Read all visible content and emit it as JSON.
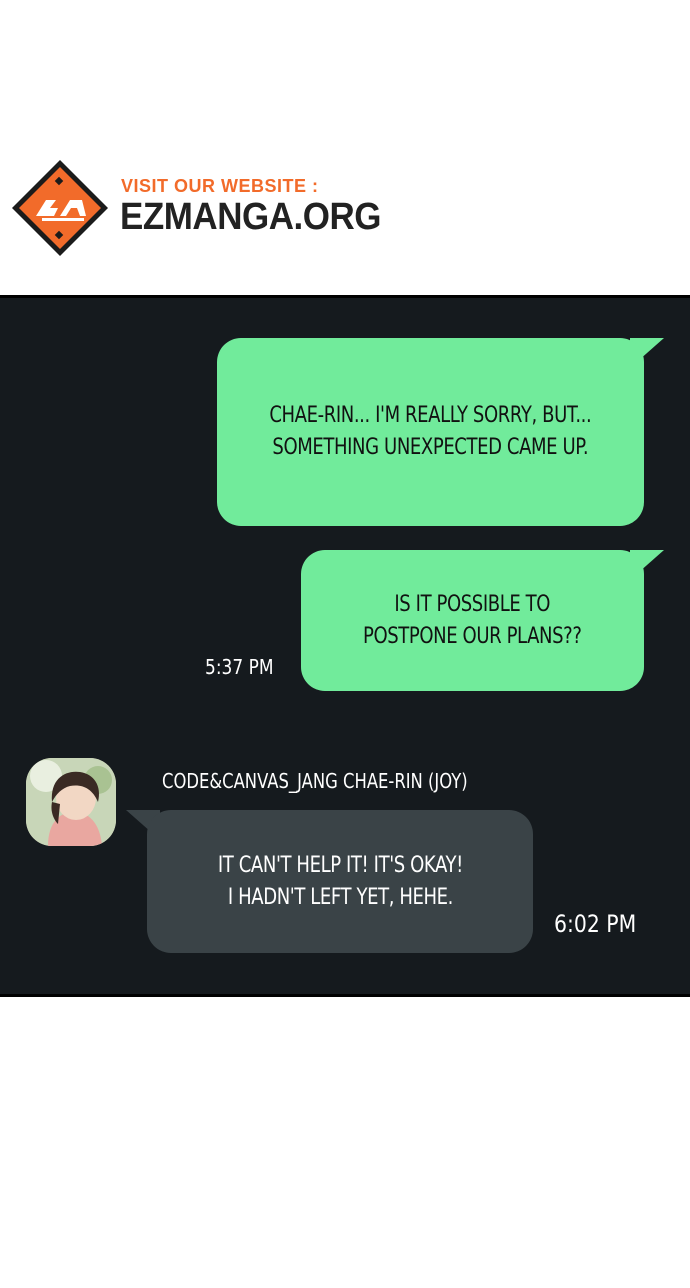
{
  "banner": {
    "visit_label": "VISIT OUR WEBSITE :",
    "site_name": "EZMANGA.ORG",
    "logo_color": "#f26b2a"
  },
  "messages": [
    {
      "from": "me",
      "lines": [
        "CHAE-RIN... I'M REALLY SORRY, BUT...",
        "SOMETHING UNEXPECTED CAME UP."
      ]
    },
    {
      "from": "me",
      "lines": [
        "IS IT POSSIBLE TO",
        "POSTPONE OUR PLANS??"
      ],
      "time": "5:37 PM"
    },
    {
      "from": "them",
      "sender": "CODE&CANVAS_JANG CHAE-RIN (JOY)",
      "lines": [
        "IT CAN'T HELP IT! IT'S OKAY!",
        "I HADN'T LEFT YET, HEHE."
      ],
      "time": "6:02 PM"
    }
  ],
  "colors": {
    "panel_bg": "#151a1e",
    "sent_bubble": "#71eb9b",
    "received_bubble": "#3a4347"
  }
}
